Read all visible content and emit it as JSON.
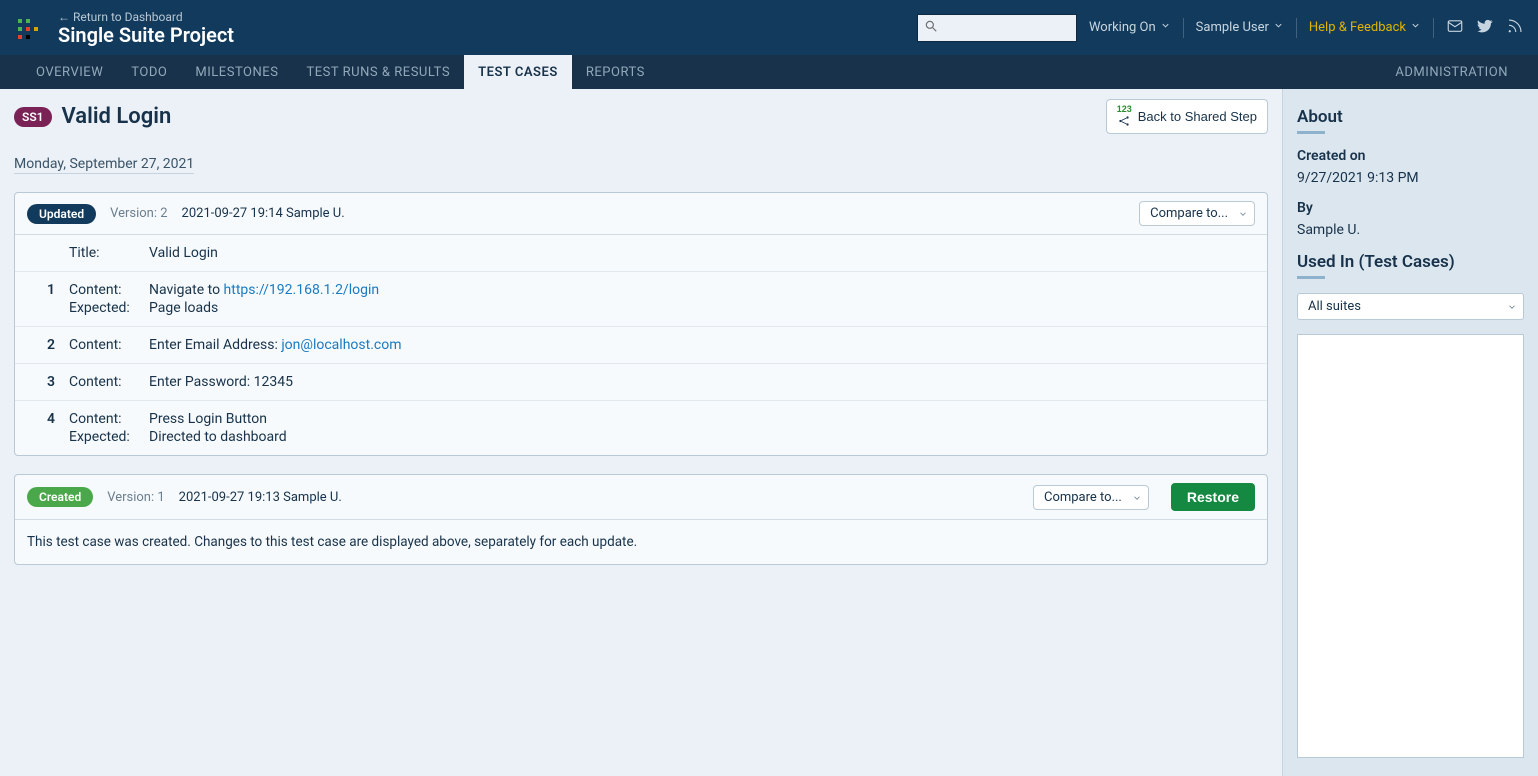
{
  "header": {
    "return_link": "← Return to Dashboard",
    "project_title": "Single Suite Project",
    "working_on": "Working On",
    "user": "Sample User",
    "help": "Help & Feedback"
  },
  "nav": {
    "tabs": [
      {
        "label": "OVERVIEW"
      },
      {
        "label": "TODO"
      },
      {
        "label": "MILESTONES"
      },
      {
        "label": "TEST RUNS & RESULTS"
      },
      {
        "label": "TEST CASES"
      },
      {
        "label": "REPORTS"
      }
    ],
    "admin": "ADMINISTRATION"
  },
  "page": {
    "id_badge": "SS1",
    "title": "Valid Login",
    "back_button": "Back to Shared Step",
    "date_heading": "Monday, September 27, 2021"
  },
  "updated": {
    "pill": "Updated",
    "version_label": "Version:",
    "version": "2",
    "timestamp": "2021-09-27 19:14",
    "author": "Sample U.",
    "compare": "Compare to...",
    "title_key": "Title:",
    "title_val": "Valid Login",
    "steps": [
      {
        "num": "1",
        "content_key": "Content:",
        "content_pre": "Navigate to ",
        "content_link": "https://192.168.1.2/login",
        "expected_key": "Expected:",
        "expected": "Page loads"
      },
      {
        "num": "2",
        "content_key": "Content:",
        "content_pre": "Enter Email Address: ",
        "content_link": "jon@localhost.com"
      },
      {
        "num": "3",
        "content_key": "Content:",
        "content_val": "Enter Password: 12345"
      },
      {
        "num": "4",
        "content_key": "Content:",
        "content_val": "Press Login Button",
        "expected_key": "Expected:",
        "expected": "Directed to dashboard"
      }
    ]
  },
  "created": {
    "pill": "Created",
    "version_label": "Version:",
    "version": "1",
    "timestamp": "2021-09-27 19:13",
    "author": "Sample U.",
    "compare": "Compare to...",
    "restore": "Restore",
    "message": "This test case was created. Changes to this test case are displayed above, separately for each update."
  },
  "sidebar": {
    "about": "About",
    "created_on_label": "Created on",
    "created_on": "9/27/2021 9:13 PM",
    "by_label": "By",
    "by": "Sample U.",
    "used_in": "Used In (Test Cases)",
    "suites_selected": "All suites"
  }
}
